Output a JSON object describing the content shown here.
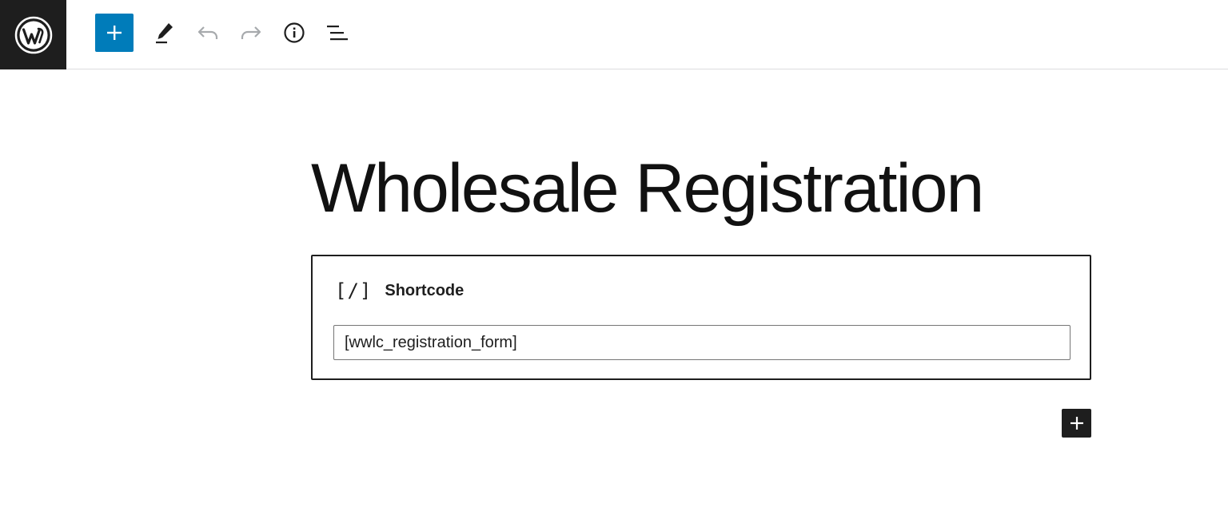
{
  "toolbar": {
    "logo_icon": "wordpress-logo-icon",
    "inserter_icon": "plus-icon",
    "tools_icon": "pencil-icon",
    "undo_icon": "undo-icon",
    "redo_icon": "redo-icon",
    "details_icon": "info-icon",
    "outline_icon": "list-view-icon",
    "accent_color": "#007cba"
  },
  "editor": {
    "post_title": "Wholesale Registration",
    "shortcode_block": {
      "icon_glyph": "[/]",
      "label": "Shortcode",
      "value": "[wwlc_registration_form]"
    },
    "append_block_icon": "plus-icon"
  }
}
